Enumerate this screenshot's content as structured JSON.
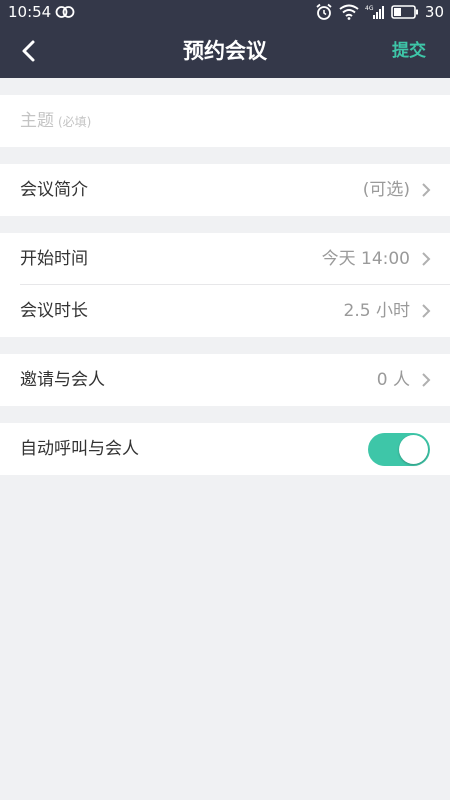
{
  "status_bar": {
    "time": "10:54",
    "battery": "30",
    "network": "4G"
  },
  "nav": {
    "title": "预约会议",
    "submit": "提交"
  },
  "subject": {
    "placeholder": "主题",
    "placeholder_note": "(必填)"
  },
  "intro": {
    "label": "会议简介",
    "value": "(可选)"
  },
  "start_time": {
    "label": "开始时间",
    "value": "今天 14:00"
  },
  "duration": {
    "label": "会议时长",
    "value": "2.5 小时"
  },
  "invite": {
    "label": "邀请与会人",
    "value": "0 人"
  },
  "auto_call": {
    "label": "自动呼叫与会人",
    "enabled": true
  },
  "colors": {
    "header_bg": "#343849",
    "accent": "#3ec6a8",
    "page_bg": "#f0f1f3"
  }
}
